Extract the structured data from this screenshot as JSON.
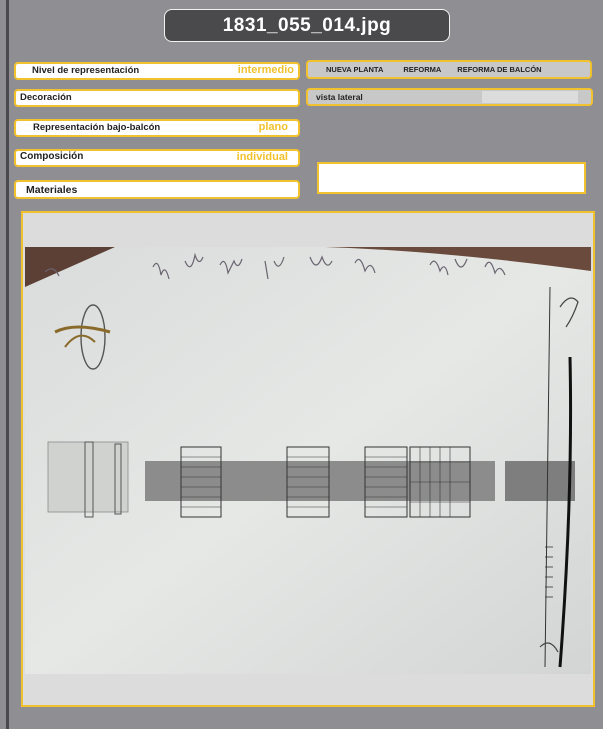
{
  "header": {
    "filename": "1831_055_014.jpg"
  },
  "fields": {
    "nivel": {
      "label": "Nivel de representación",
      "value": "intermedio"
    },
    "decoracion": {
      "label": "Decoración"
    },
    "bajo_balcon": {
      "label": "Representación bajo-balcón",
      "value": "plano"
    },
    "composicion": {
      "label": "Composición",
      "value": "individual"
    },
    "materiales": {
      "label": "Materiales"
    }
  },
  "tabs": [
    "NUEVA PLANTA",
    "REFORMA",
    "REFORMA DE BALCÓN"
  ],
  "view": {
    "label": "vista lateral"
  },
  "colors": {
    "accent": "#f2c12e",
    "title_bg": "#4a4a4c",
    "page_bg": "#8f8f93"
  }
}
